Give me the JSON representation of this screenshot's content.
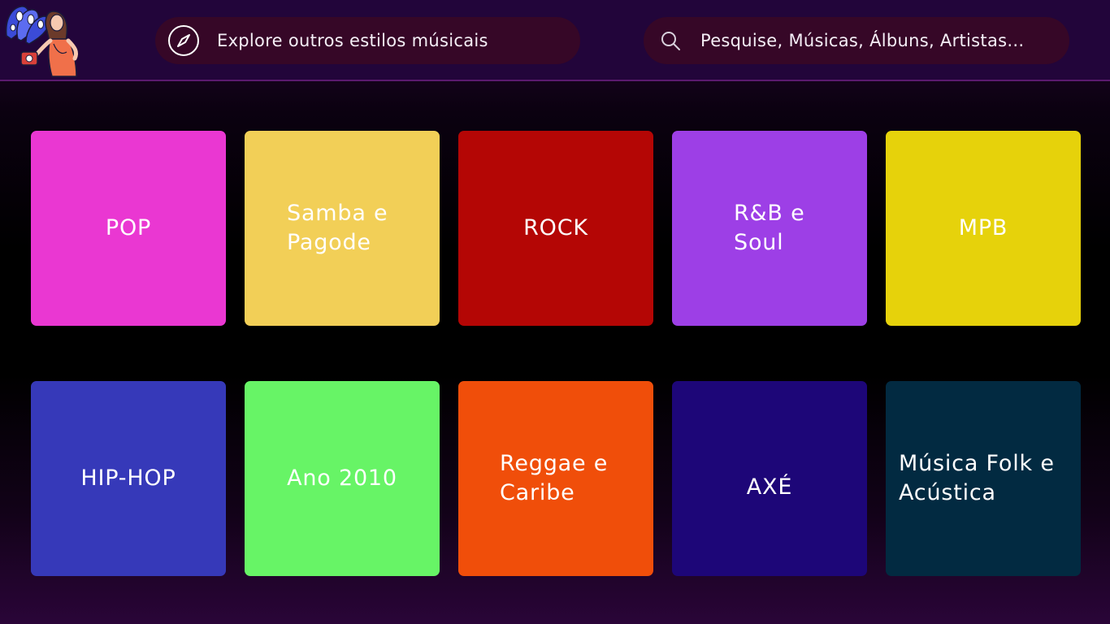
{
  "header": {
    "explore_label": "Explore outros estilos músicais",
    "search_placeholder": "Pesquise, Músicas, Álbuns, Artistas..."
  },
  "genres": [
    {
      "label": "POP",
      "color": "#ea37d2"
    },
    {
      "label": "Samba e\nPagode",
      "color": "#f2cf57"
    },
    {
      "label": "ROCK",
      "color": "#b40605"
    },
    {
      "label": "R&B e\nSoul",
      "color": "#9d3fe6"
    },
    {
      "label": "MPB",
      "color": "#e6d20b"
    },
    {
      "label": "HIP-HOP",
      "color": "#3639b9"
    },
    {
      "label": "Ano 2010",
      "color": "#67f466"
    },
    {
      "label": "Reggae e\nCaribe",
      "color": "#f04e0a"
    },
    {
      "label": "AXÉ",
      "color": "#1d0678"
    },
    {
      "label": "Música Folk e\nAcústica",
      "color": "#022a41"
    }
  ],
  "icons": {
    "logo": "logo-illustration-icon",
    "explore": "compass-icon",
    "search": "search-icon"
  }
}
